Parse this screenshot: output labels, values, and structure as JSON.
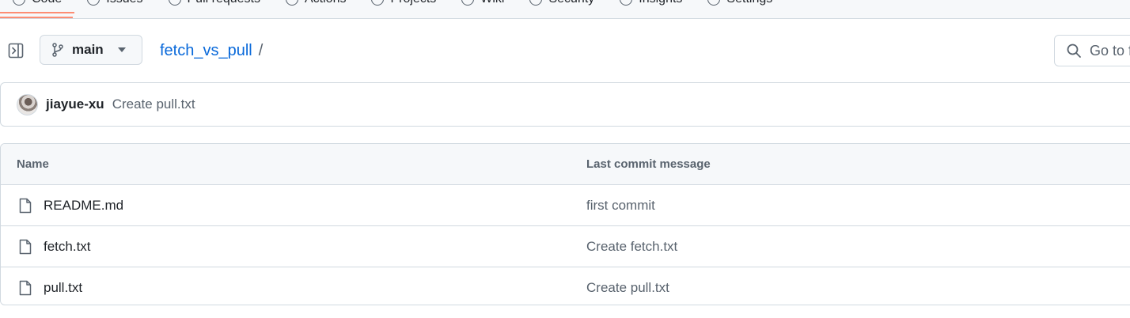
{
  "nav": {
    "tabs": [
      {
        "label": "Code",
        "icon": "code-icon"
      },
      {
        "label": "Issues",
        "icon": "issue-icon"
      },
      {
        "label": "Pull requests",
        "icon": "pull-request-icon"
      },
      {
        "label": "Actions",
        "icon": "play-icon"
      },
      {
        "label": "Projects",
        "icon": "table-icon"
      },
      {
        "label": "Wiki",
        "icon": "book-icon"
      },
      {
        "label": "Security",
        "icon": "shield-icon"
      },
      {
        "label": "Insights",
        "icon": "graph-icon"
      },
      {
        "label": "Settings",
        "icon": "gear-icon"
      }
    ],
    "active_color": "#fd8c73"
  },
  "toolbar": {
    "branch": "main",
    "repo": "fetch_vs_pull",
    "separator": "/",
    "goto_placeholder": "Go to file"
  },
  "latest_commit": {
    "author": "jiayue-xu",
    "message": "Create pull.txt"
  },
  "files": {
    "headers": {
      "name": "Name",
      "message": "Last commit message"
    },
    "rows": [
      {
        "name": "README.md",
        "message": "first commit"
      },
      {
        "name": "fetch.txt",
        "message": "Create fetch.txt"
      },
      {
        "name": "pull.txt",
        "message": "Create pull.txt"
      }
    ]
  },
  "colors": {
    "link": "#0969da",
    "border": "#d1d9e0",
    "muted": "#59636e"
  }
}
